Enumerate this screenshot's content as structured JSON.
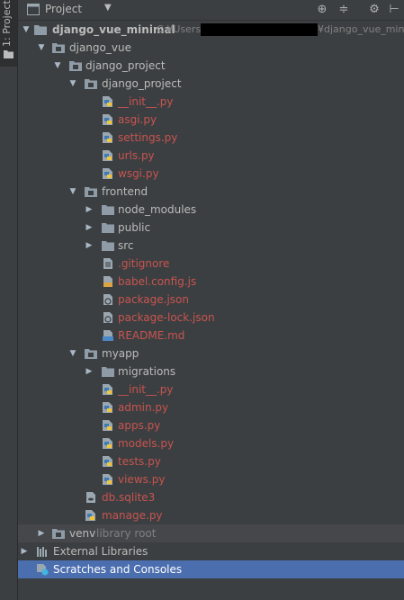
{
  "side_tab": {
    "label": "1: Project"
  },
  "header": {
    "title": "Project",
    "caret": "▼"
  },
  "tree": {
    "root": {
      "name": "django_vue_minimal",
      "path_prefix": "C:¥Users¥",
      "path_suffix": "¥django_vue_minin"
    },
    "django_vue": "django_vue",
    "django_project_outer": "django_project",
    "django_project_inner": "django_project",
    "init_1": "__init__.py",
    "asgi": "asgi.py",
    "settings": "settings.py",
    "urls": "urls.py",
    "wsgi": "wsgi.py",
    "frontend": "frontend",
    "node_modules": "node_modules",
    "public": "public",
    "src": "src",
    "gitignore": ".gitignore",
    "babel": "babel.config.js",
    "package_json": "package.json",
    "package_lock": "package-lock.json",
    "readme": "README.md",
    "myapp": "myapp",
    "migrations": "migrations",
    "init_2": "__init__.py",
    "admin": "admin.py",
    "apps": "apps.py",
    "models": "models.py",
    "tests": "tests.py",
    "views": "views.py",
    "db": "db.sqlite3",
    "manage": "manage.py",
    "venv": "venv",
    "venv_note": "library root",
    "external": "External Libraries",
    "scratches": "Scratches and Consoles"
  },
  "colors": {
    "selection": "#4b6eaf",
    "modified": "#c75450",
    "background": "#3c3f41"
  }
}
